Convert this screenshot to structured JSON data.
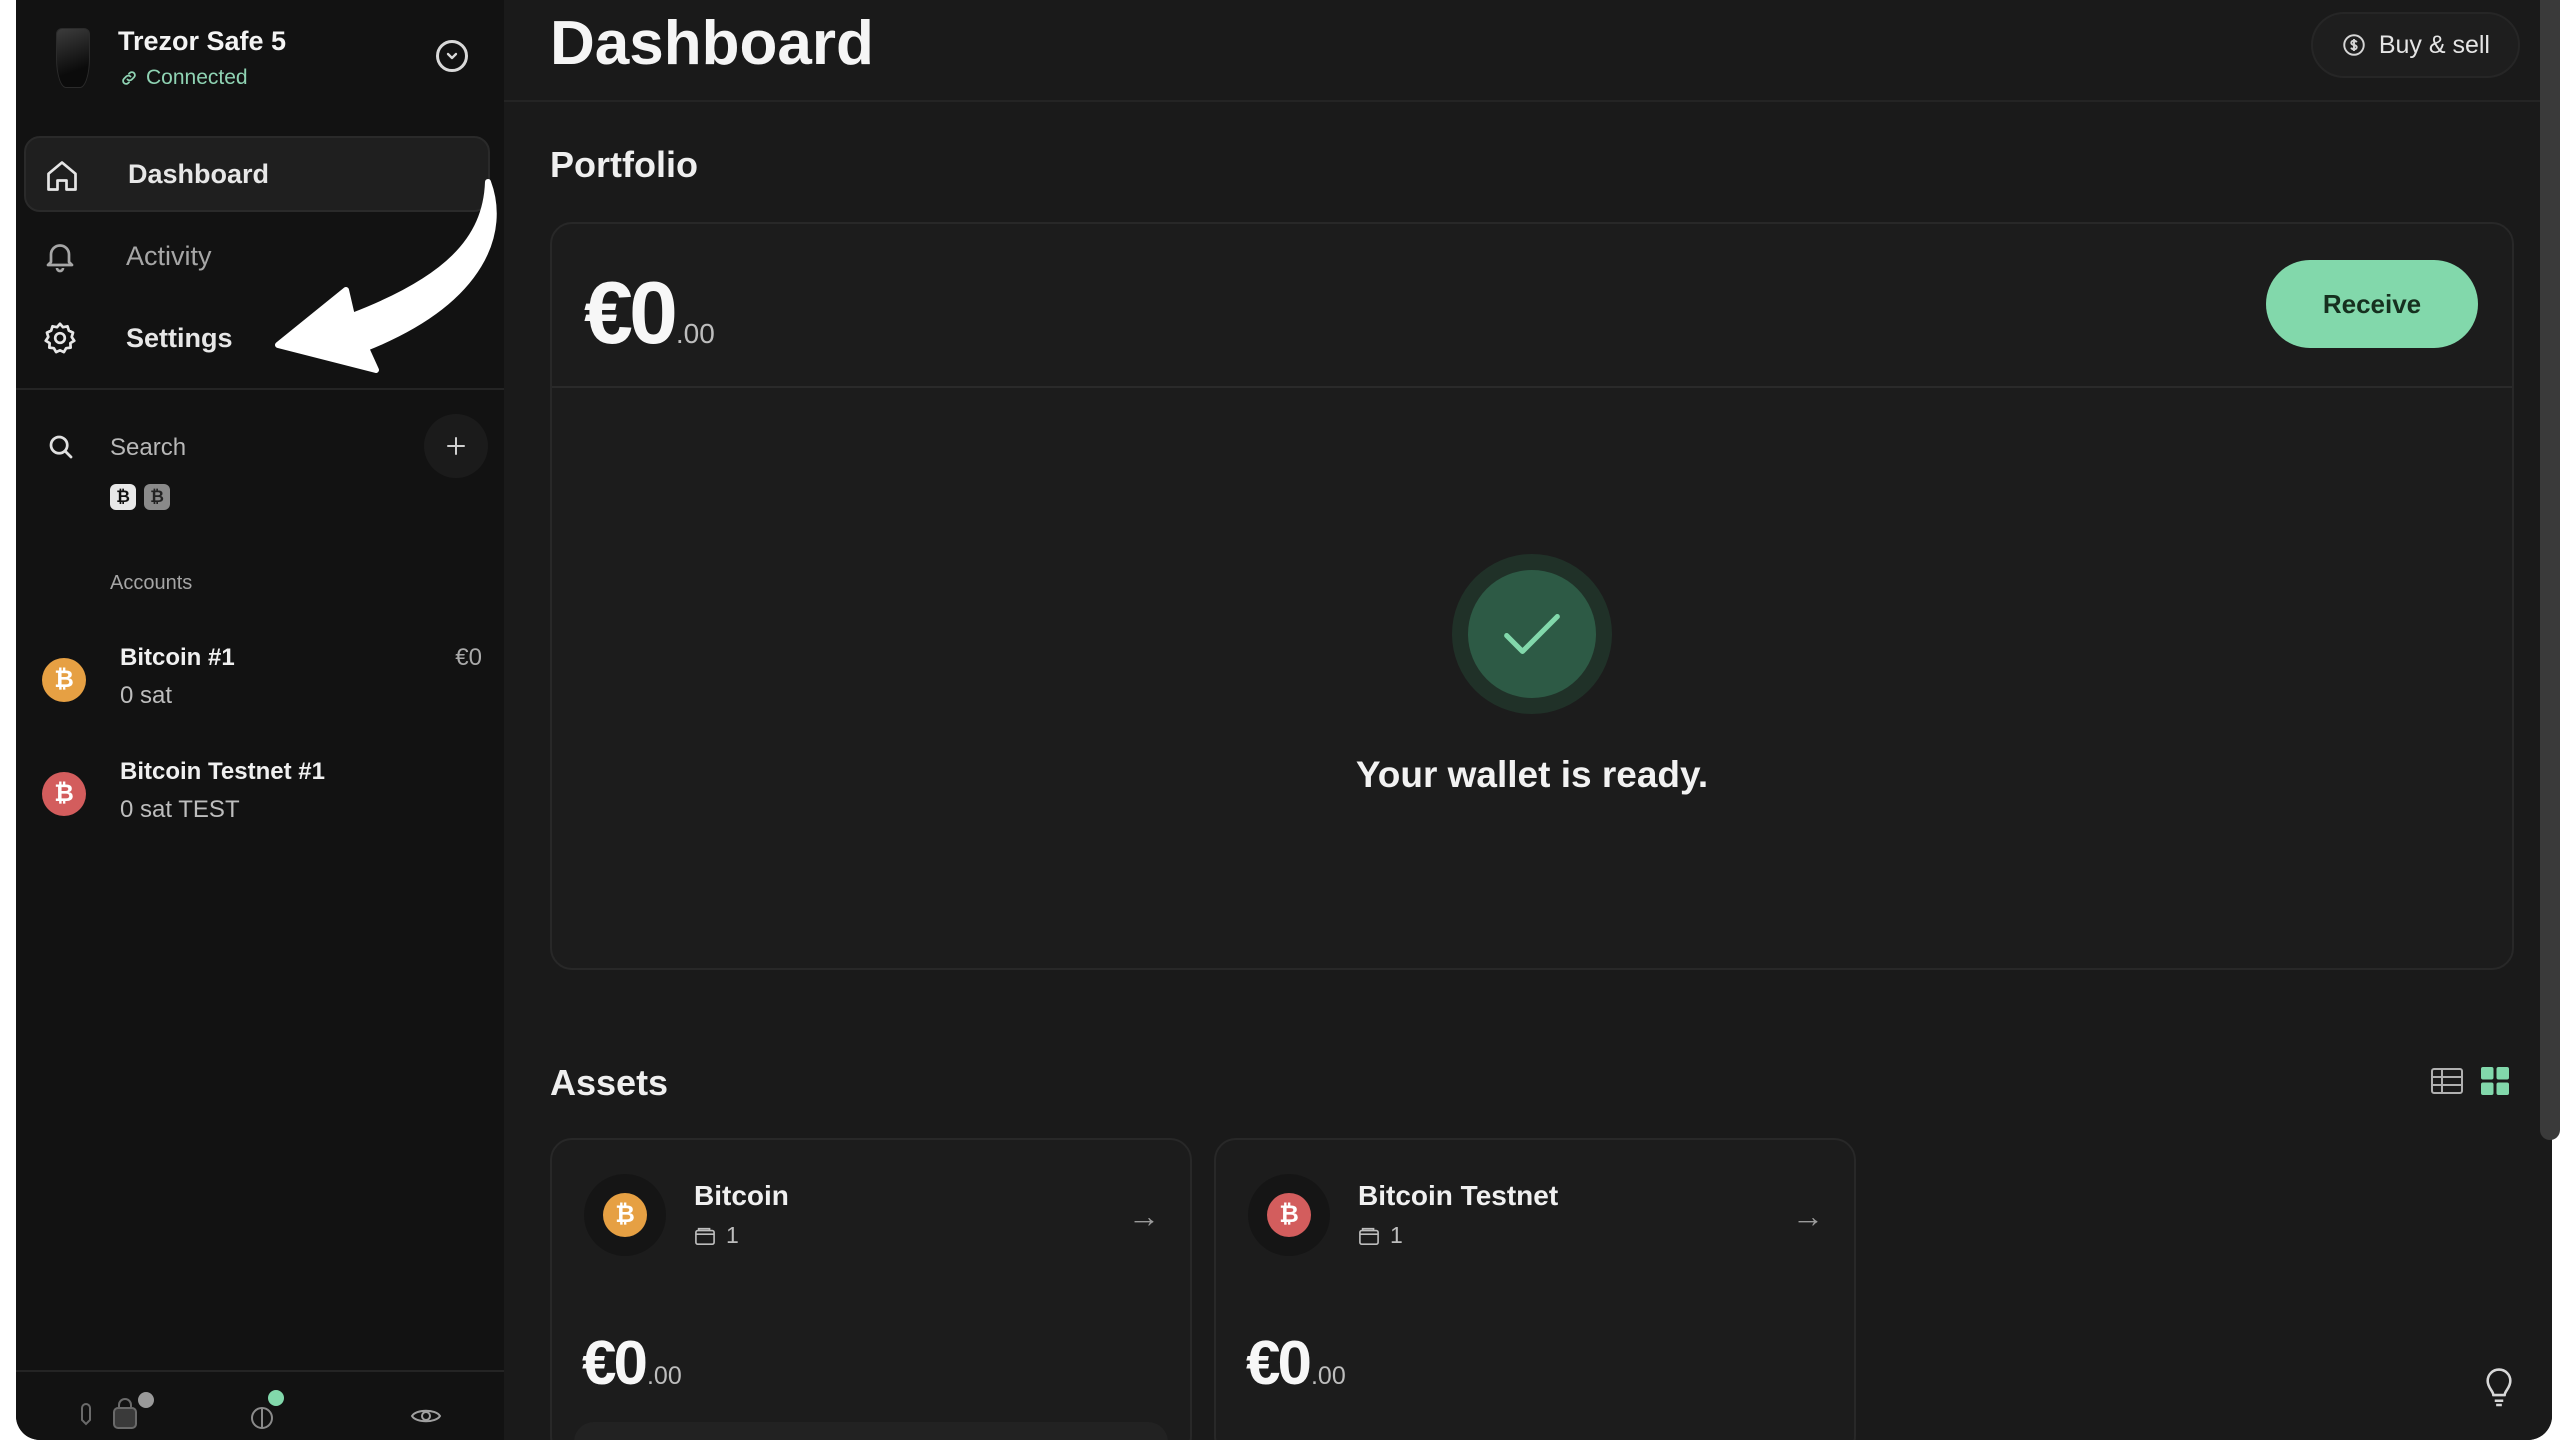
{
  "device": {
    "name": "Trezor Safe 5",
    "status": "Connected"
  },
  "nav": {
    "items": [
      {
        "label": "Dashboard",
        "icon": "home-icon",
        "active": true
      },
      {
        "label": "Activity",
        "icon": "bell-icon",
        "active": false
      },
      {
        "label": "Settings",
        "icon": "gear-icon",
        "active": false
      }
    ]
  },
  "search": {
    "label": "Search",
    "coin_filters": [
      "₿",
      "₿"
    ]
  },
  "accounts": {
    "heading": "Accounts",
    "items": [
      {
        "name": "Bitcoin #1",
        "balance": "0 sat",
        "fiat": "€0",
        "color": "#e6a043"
      },
      {
        "name": "Bitcoin Testnet #1",
        "balance": "0 sat TEST",
        "fiat": "",
        "color": "#d35d5d"
      }
    ]
  },
  "header": {
    "title": "Dashboard",
    "buy_sell_label": "Buy & sell"
  },
  "portfolio": {
    "title": "Portfolio",
    "amount_main": "€0",
    "amount_decimals": ".00",
    "receive_label": "Receive",
    "ready_text": "Your wallet is ready."
  },
  "assets": {
    "title": "Assets",
    "items": [
      {
        "name": "Bitcoin",
        "accounts_count": "1",
        "amount_main": "€0",
        "amount_decimals": ".00",
        "color": "#e6a043"
      },
      {
        "name": "Bitcoin Testnet",
        "accounts_count": "1",
        "amount_main": "€0",
        "amount_decimals": ".00",
        "color": "#d35d5d"
      }
    ]
  },
  "colors": {
    "accent_green": "#82d8ab",
    "bitcoin_orange": "#e6a043",
    "testnet_red": "#d35d5d",
    "background": "#191919"
  }
}
